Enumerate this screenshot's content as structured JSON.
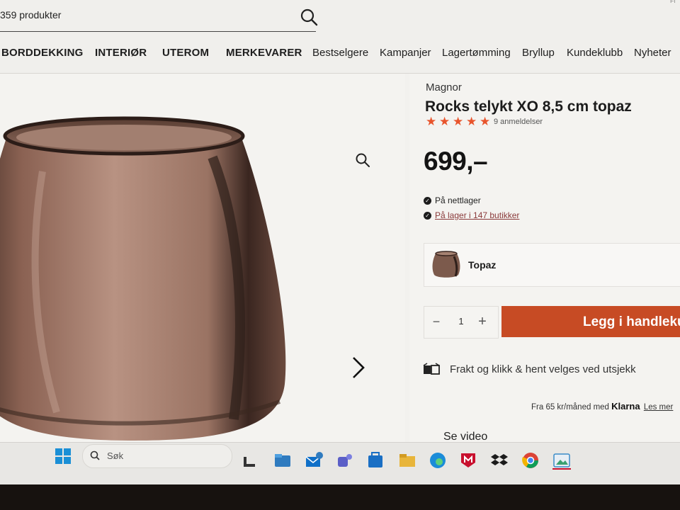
{
  "header": {
    "search": {
      "value": "359 produkter"
    },
    "corner_text": "Fi",
    "nav": [
      "BORDDEKKING",
      "INTERIØR",
      "UTEROM",
      "MERKEVARER",
      "Bestselgere",
      "Kampanjer",
      "Lagertømming",
      "Bryllup",
      "Kundeklubb",
      "Nyheter"
    ]
  },
  "product": {
    "brand": "Magnor",
    "title": "Rocks telykt XO 8,5 cm topaz",
    "rating": 5,
    "reviews": "9 anmeldelser",
    "price": "699,–",
    "stock_online": "På nettlager",
    "stock_stores": "På lager i 147 butikker",
    "variant": "Topaz",
    "quantity": "1",
    "cart_button": "Legg i handlekurv",
    "shipping": "Frakt og klikk & hent velges ved utsjekk",
    "klarna_prefix": "Fra 65 kr/måned med",
    "klarna_brand": "Klarna",
    "klarna_link": "Les mer",
    "video": "Se video"
  },
  "taskbar": {
    "search_text": "Søk",
    "icons": [
      "windows-start",
      "file-explorer",
      "outlook",
      "teams",
      "microsoft-store",
      "folder",
      "edge",
      "mcafee",
      "dropbox",
      "chrome",
      "photos"
    ]
  },
  "colors": {
    "accent": "#c74b24",
    "star": "#e8542c"
  }
}
